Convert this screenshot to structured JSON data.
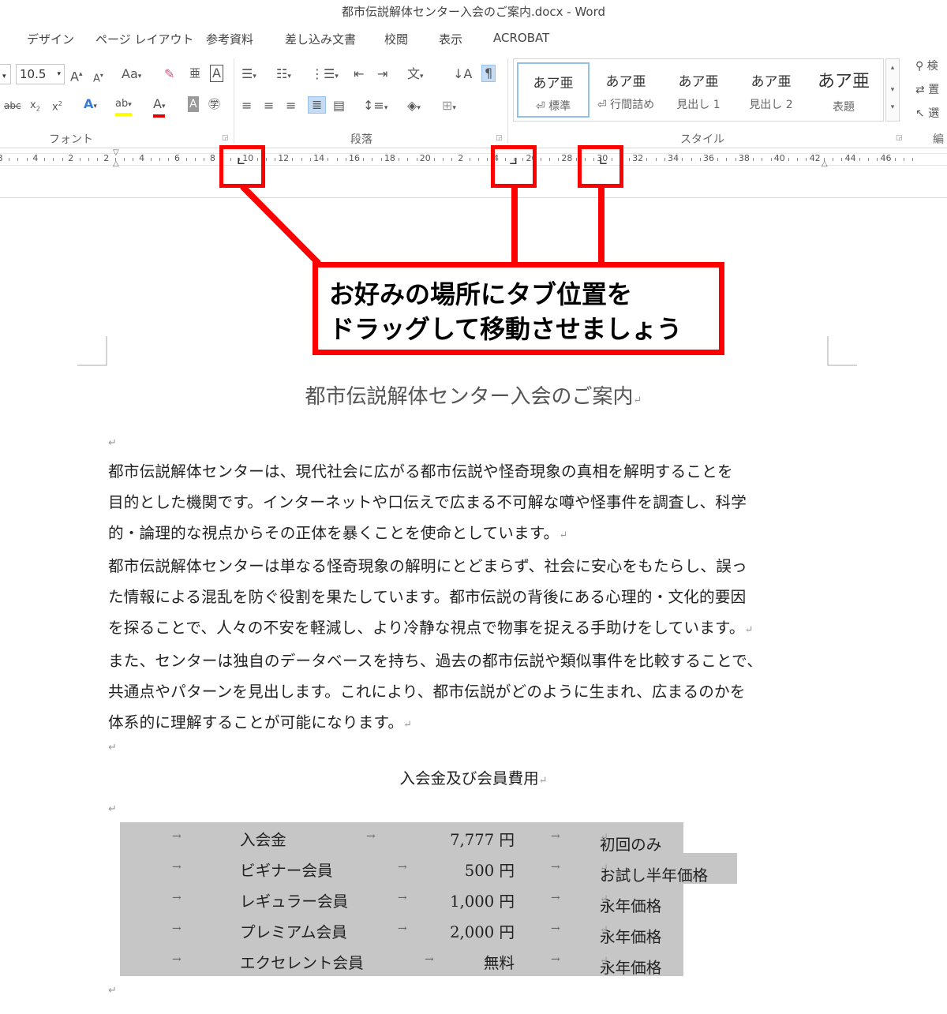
{
  "window": {
    "title": "都市伝説解体センター入会のご案内.docx - Word"
  },
  "menu_tabs": [
    "デザイン",
    "ページ レイアウト",
    "参考資料",
    "差し込み文書",
    "校閲",
    "表示",
    "ACROBAT"
  ],
  "ribbon": {
    "font_size": "10.5",
    "groups": {
      "font": "フォント",
      "paragraph": "段落",
      "styles": "スタイル",
      "editing": "編"
    },
    "styles": [
      {
        "sample": "あア亜",
        "name": "⏎ 標準"
      },
      {
        "sample": "あア亜",
        "name": "⏎ 行間詰め"
      },
      {
        "sample": "あア亜",
        "name": "見出し 1"
      },
      {
        "sample": "あア亜",
        "name": "見出し 2"
      },
      {
        "sample": "あア亜",
        "name": "表題"
      }
    ],
    "editing_items": [
      "検",
      "置",
      "選"
    ]
  },
  "ruler": {
    "labels": [
      "8",
      "4",
      "2",
      "2",
      "4",
      "6",
      "8",
      "10",
      "12",
      "14",
      "16",
      "18",
      "20",
      "2",
      "4",
      "26",
      "28",
      "30",
      "32",
      "34",
      "36",
      "38",
      "40",
      "42",
      "44",
      "46"
    ]
  },
  "annotation": {
    "line1": "お好みの場所にタブ位置を",
    "line2": "ドラッグして移動させましょう"
  },
  "document": {
    "title": "都市伝説解体センター入会のご案内",
    "paragraph_mark": "↵",
    "lines": [
      "都市伝説解体センターは、現代社会に広がる都市伝説や怪奇現象の真相を解明することを",
      "目的とした機関です。インターネットや口伝えで広まる不可解な噂や怪事件を調査し、科学",
      "的・論理的な視点からその正体を暴くことを使命としています。",
      "都市伝説解体センターは単なる怪奇現象の解明にとどまらず、社会に安心をもたらし、誤っ",
      "た情報による混乱を防ぐ役割を果たしています。都市伝説の背後にある心理的・文化的要因",
      "を探ることで、人々の不安を軽減し、より冷静な視点で物事を捉える手助けをしています。",
      "また、センターは独自のデータベースを持ち、過去の都市伝説や類似事件を比較することで、",
      "共通点やパターンを見出します。これにより、都市伝説がどのように生まれ、広まるのかを",
      "体系的に理解することが可能になります。"
    ],
    "fee_heading": "入会金及び会員費用",
    "tab_arrow": "→",
    "fees": [
      {
        "name": "入会金",
        "price": "7,777 円",
        "note": "初回のみ"
      },
      {
        "name": "ビギナー会員",
        "price": "500 円",
        "note": "お試し半年価格"
      },
      {
        "name": "レギュラー会員",
        "price": "1,000 円",
        "note": "永年価格"
      },
      {
        "name": "プレミアム会員",
        "price": "2,000 円",
        "note": "永年価格"
      },
      {
        "name": "エクセレント会員",
        "price": "無料",
        "note": "永年価格"
      }
    ]
  },
  "colors": {
    "annotation_red": "#ff0000",
    "tab_highlight": "#c6c6c6"
  }
}
